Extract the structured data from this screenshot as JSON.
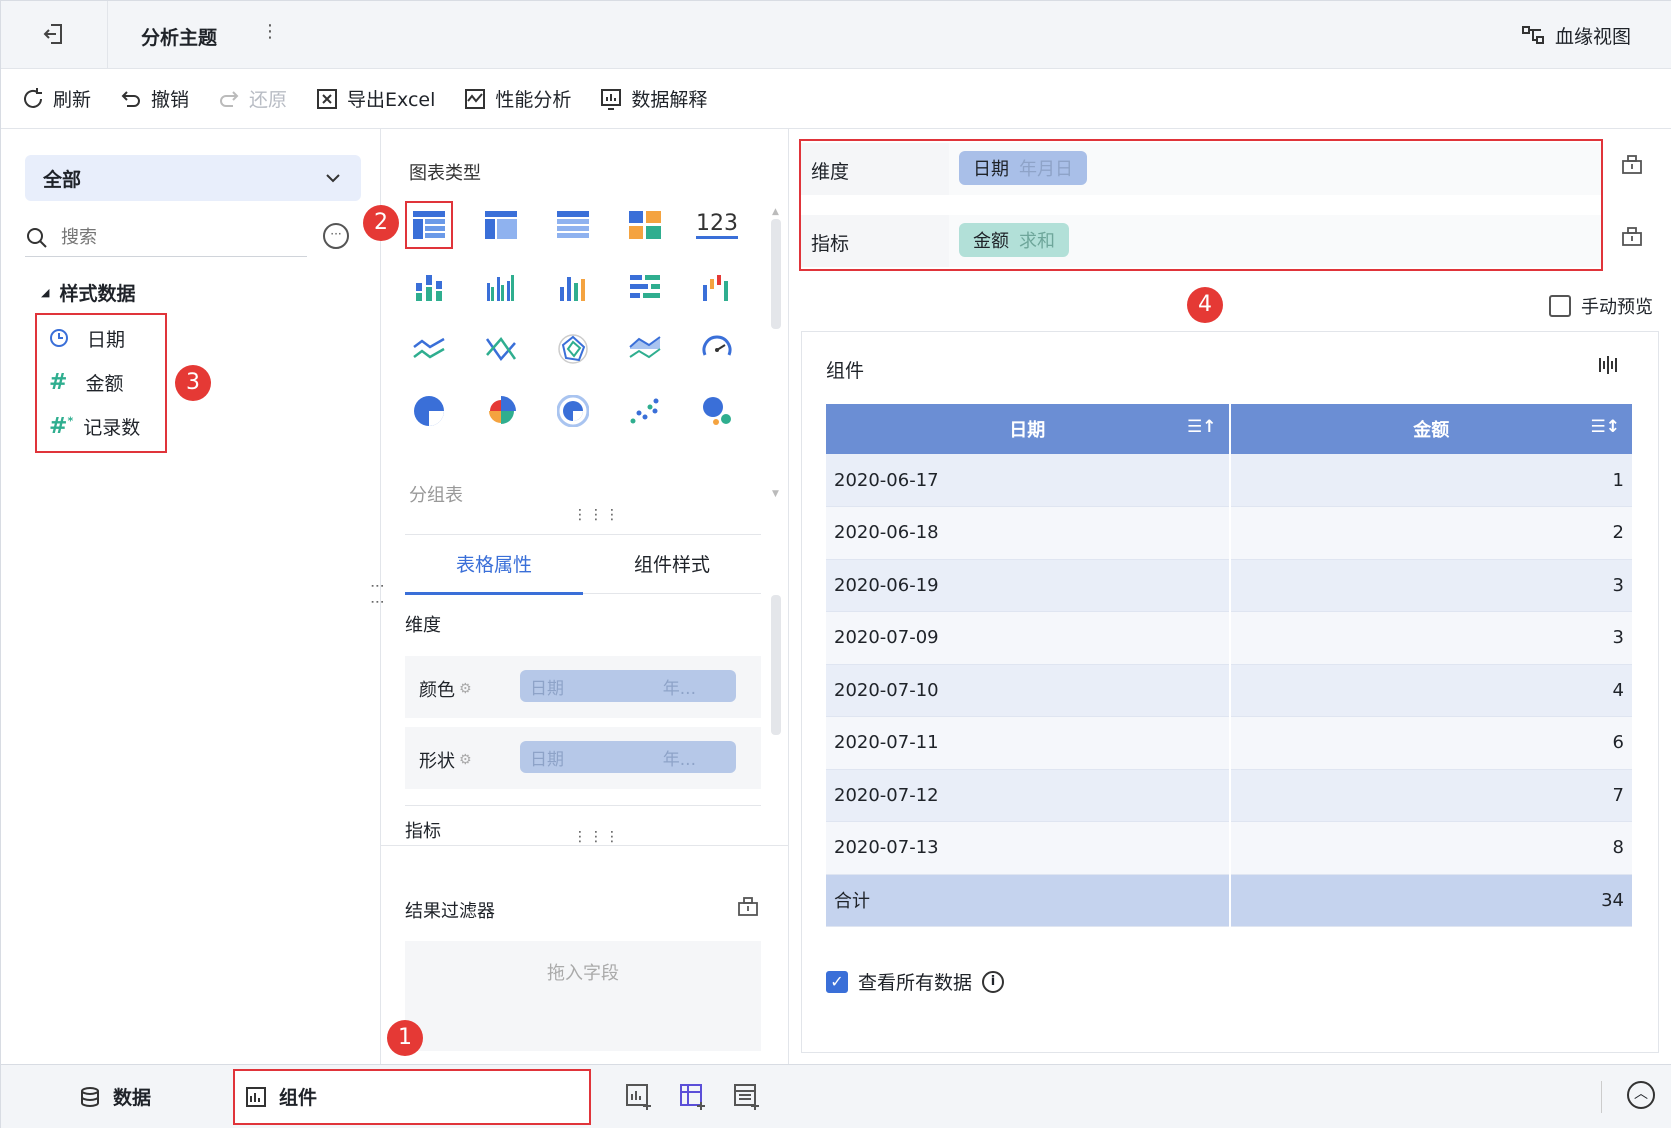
{
  "header": {
    "title": "分析主题",
    "lineage_label": "血缘视图"
  },
  "toolbar": {
    "refresh": "刷新",
    "undo": "撤销",
    "redo": "还原",
    "export_excel": "导出Excel",
    "perf_analysis": "性能分析",
    "data_explain": "数据解释"
  },
  "data_panel": {
    "scope": "全部",
    "search_placeholder": "搜索",
    "group_name": "样式数据",
    "fields": [
      {
        "label": "日期",
        "icon": "clock-icon"
      },
      {
        "label": "金额",
        "icon": "hash-icon"
      },
      {
        "label": "记录数",
        "icon": "hash-star-icon"
      }
    ]
  },
  "chart_panel": {
    "chart_types_label": "图表类型",
    "selected_type_label": "分组表",
    "tabs": [
      "表格属性",
      "组件样式"
    ],
    "dimension_label": "维度",
    "color_label": "颜色",
    "shape_label": "形状",
    "pill_field": "日期",
    "pill_suffix": "年...",
    "measure_label": "指标",
    "filter_label": "结果过滤器",
    "drop_hint": "拖入字段",
    "number_icon_text": "123"
  },
  "shelves": {
    "dimension_label": "维度",
    "dimension_field": "日期",
    "dimension_agg": "年月日",
    "measure_label": "指标",
    "measure_field": "金额",
    "measure_agg": "求和",
    "manual_preview": "手动预览"
  },
  "component": {
    "title": "组件",
    "columns": [
      "日期",
      "金额"
    ],
    "rows": [
      {
        "date": "2020-06-17",
        "amount": "1"
      },
      {
        "date": "2020-06-18",
        "amount": "2"
      },
      {
        "date": "2020-06-19",
        "amount": "3"
      },
      {
        "date": "2020-07-09",
        "amount": "3"
      },
      {
        "date": "2020-07-10",
        "amount": "4"
      },
      {
        "date": "2020-07-11",
        "amount": "6"
      },
      {
        "date": "2020-07-12",
        "amount": "7"
      },
      {
        "date": "2020-07-13",
        "amount": "8"
      }
    ],
    "total_label": "合计",
    "total_value": "34",
    "view_all_label": "查看所有数据"
  },
  "bottom": {
    "data_tab": "数据",
    "component_tab": "组件"
  },
  "badges": [
    "1",
    "2",
    "3",
    "4"
  ],
  "colors": {
    "accent": "#3a6fd8",
    "header_blue": "#6b8ed4",
    "highlight_red": "#e0343a",
    "measure_pill": "#b2e0d8",
    "dimension_pill": "#a9bfe8"
  }
}
